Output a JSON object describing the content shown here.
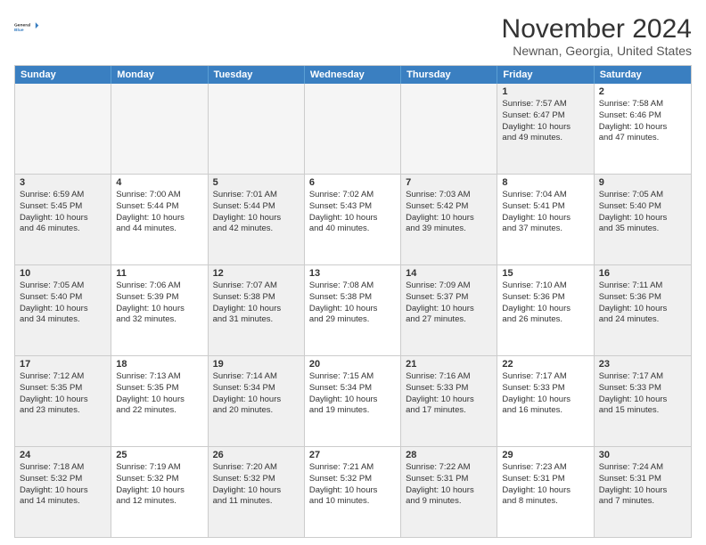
{
  "logo": {
    "line1": "General",
    "line2": "Blue"
  },
  "title": "November 2024",
  "location": "Newnan, Georgia, United States",
  "days_of_week": [
    "Sunday",
    "Monday",
    "Tuesday",
    "Wednesday",
    "Thursday",
    "Friday",
    "Saturday"
  ],
  "weeks": [
    [
      {
        "day": "",
        "info": "",
        "empty": true
      },
      {
        "day": "",
        "info": "",
        "empty": true
      },
      {
        "day": "",
        "info": "",
        "empty": true
      },
      {
        "day": "",
        "info": "",
        "empty": true
      },
      {
        "day": "",
        "info": "",
        "empty": true
      },
      {
        "day": "1",
        "info": "Sunrise: 7:57 AM\nSunset: 6:47 PM\nDaylight: 10 hours\nand 49 minutes.",
        "shaded": true
      },
      {
        "day": "2",
        "info": "Sunrise: 7:58 AM\nSunset: 6:46 PM\nDaylight: 10 hours\nand 47 minutes.",
        "shaded": false
      }
    ],
    [
      {
        "day": "3",
        "info": "Sunrise: 6:59 AM\nSunset: 5:45 PM\nDaylight: 10 hours\nand 46 minutes.",
        "shaded": true
      },
      {
        "day": "4",
        "info": "Sunrise: 7:00 AM\nSunset: 5:44 PM\nDaylight: 10 hours\nand 44 minutes.",
        "shaded": false
      },
      {
        "day": "5",
        "info": "Sunrise: 7:01 AM\nSunset: 5:44 PM\nDaylight: 10 hours\nand 42 minutes.",
        "shaded": true
      },
      {
        "day": "6",
        "info": "Sunrise: 7:02 AM\nSunset: 5:43 PM\nDaylight: 10 hours\nand 40 minutes.",
        "shaded": false
      },
      {
        "day": "7",
        "info": "Sunrise: 7:03 AM\nSunset: 5:42 PM\nDaylight: 10 hours\nand 39 minutes.",
        "shaded": true
      },
      {
        "day": "8",
        "info": "Sunrise: 7:04 AM\nSunset: 5:41 PM\nDaylight: 10 hours\nand 37 minutes.",
        "shaded": false
      },
      {
        "day": "9",
        "info": "Sunrise: 7:05 AM\nSunset: 5:40 PM\nDaylight: 10 hours\nand 35 minutes.",
        "shaded": true
      }
    ],
    [
      {
        "day": "10",
        "info": "Sunrise: 7:05 AM\nSunset: 5:40 PM\nDaylight: 10 hours\nand 34 minutes.",
        "shaded": true
      },
      {
        "day": "11",
        "info": "Sunrise: 7:06 AM\nSunset: 5:39 PM\nDaylight: 10 hours\nand 32 minutes.",
        "shaded": false
      },
      {
        "day": "12",
        "info": "Sunrise: 7:07 AM\nSunset: 5:38 PM\nDaylight: 10 hours\nand 31 minutes.",
        "shaded": true
      },
      {
        "day": "13",
        "info": "Sunrise: 7:08 AM\nSunset: 5:38 PM\nDaylight: 10 hours\nand 29 minutes.",
        "shaded": false
      },
      {
        "day": "14",
        "info": "Sunrise: 7:09 AM\nSunset: 5:37 PM\nDaylight: 10 hours\nand 27 minutes.",
        "shaded": true
      },
      {
        "day": "15",
        "info": "Sunrise: 7:10 AM\nSunset: 5:36 PM\nDaylight: 10 hours\nand 26 minutes.",
        "shaded": false
      },
      {
        "day": "16",
        "info": "Sunrise: 7:11 AM\nSunset: 5:36 PM\nDaylight: 10 hours\nand 24 minutes.",
        "shaded": true
      }
    ],
    [
      {
        "day": "17",
        "info": "Sunrise: 7:12 AM\nSunset: 5:35 PM\nDaylight: 10 hours\nand 23 minutes.",
        "shaded": true
      },
      {
        "day": "18",
        "info": "Sunrise: 7:13 AM\nSunset: 5:35 PM\nDaylight: 10 hours\nand 22 minutes.",
        "shaded": false
      },
      {
        "day": "19",
        "info": "Sunrise: 7:14 AM\nSunset: 5:34 PM\nDaylight: 10 hours\nand 20 minutes.",
        "shaded": true
      },
      {
        "day": "20",
        "info": "Sunrise: 7:15 AM\nSunset: 5:34 PM\nDaylight: 10 hours\nand 19 minutes.",
        "shaded": false
      },
      {
        "day": "21",
        "info": "Sunrise: 7:16 AM\nSunset: 5:33 PM\nDaylight: 10 hours\nand 17 minutes.",
        "shaded": true
      },
      {
        "day": "22",
        "info": "Sunrise: 7:17 AM\nSunset: 5:33 PM\nDaylight: 10 hours\nand 16 minutes.",
        "shaded": false
      },
      {
        "day": "23",
        "info": "Sunrise: 7:17 AM\nSunset: 5:33 PM\nDaylight: 10 hours\nand 15 minutes.",
        "shaded": true
      }
    ],
    [
      {
        "day": "24",
        "info": "Sunrise: 7:18 AM\nSunset: 5:32 PM\nDaylight: 10 hours\nand 14 minutes.",
        "shaded": true
      },
      {
        "day": "25",
        "info": "Sunrise: 7:19 AM\nSunset: 5:32 PM\nDaylight: 10 hours\nand 12 minutes.",
        "shaded": false
      },
      {
        "day": "26",
        "info": "Sunrise: 7:20 AM\nSunset: 5:32 PM\nDaylight: 10 hours\nand 11 minutes.",
        "shaded": true
      },
      {
        "day": "27",
        "info": "Sunrise: 7:21 AM\nSunset: 5:32 PM\nDaylight: 10 hours\nand 10 minutes.",
        "shaded": false
      },
      {
        "day": "28",
        "info": "Sunrise: 7:22 AM\nSunset: 5:31 PM\nDaylight: 10 hours\nand 9 minutes.",
        "shaded": true
      },
      {
        "day": "29",
        "info": "Sunrise: 7:23 AM\nSunset: 5:31 PM\nDaylight: 10 hours\nand 8 minutes.",
        "shaded": false
      },
      {
        "day": "30",
        "info": "Sunrise: 7:24 AM\nSunset: 5:31 PM\nDaylight: 10 hours\nand 7 minutes.",
        "shaded": true
      }
    ]
  ]
}
